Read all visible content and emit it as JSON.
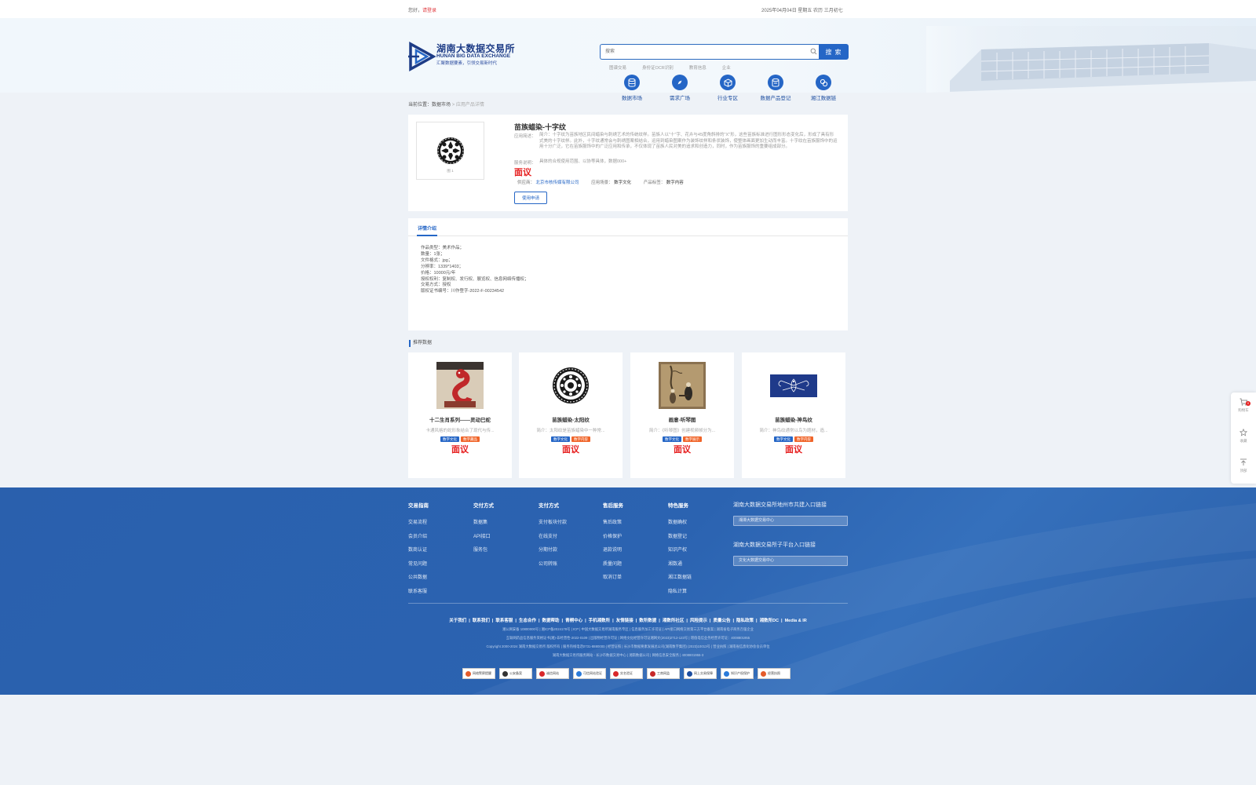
{
  "topbar": {
    "greeting": "您好，",
    "login": "请登录",
    "date": "2025年04月04日 星期五 农历 三月初七"
  },
  "logo": {
    "cn": "湖南大数据交易所",
    "en": "HUNAN BIG DATA EXCHANGE",
    "slogan": "汇聚数据要素，引领交易新时代"
  },
  "search": {
    "placeholder": "搜索",
    "button": "搜 索",
    "hotwords": [
      "图谱交易",
      "身份证OCR识别",
      "教育信息",
      "企业"
    ]
  },
  "nav": [
    {
      "label": "数据市场",
      "icon": "database-icon"
    },
    {
      "label": "需求广场",
      "icon": "compass-icon"
    },
    {
      "label": "行业专区",
      "icon": "cube-icon"
    },
    {
      "label": "数据产品登记",
      "icon": "register-icon"
    },
    {
      "label": "湘江数据链",
      "icon": "chain-icon"
    }
  ],
  "breadcrumb": {
    "prefix": "当前位置：",
    "level1": "数据市场",
    "sep": " > ",
    "current": "应用产品详情"
  },
  "product": {
    "image_caption": "图 1",
    "title": "苗族蜡染-十字纹",
    "intro_label": "应用简述：",
    "intro": "简介：十字纹为苗族地区民间蜡染与刺绣艺术的传统纹样。苗族人以\"十\"字、花卉与45度角斜排的\"X\"形，这些苗族标准进行图形形态变化后，形成了具有形式美的十字纹样。此外，十字纹通常会与刺绣图案相结合，运用到蜡染图案作为装饰纹样和条状装饰，使整体画面更加生动而丰富。十字纹在苗族服饰中的运用十分广泛，它在苗族服饰中的广泛应用和传承，不仅体现了苗族人民对美的追求和创造力，同时，作为苗族服饰的重要组成部分。",
    "service_label": "服务说明：",
    "service": "具体的合规使用范围、以协等具体，数据000+",
    "price": "面议",
    "provider_label": "供应商：",
    "provider": "北京市核传媒有限公司",
    "scene_label": "应用场景：",
    "scene": "数字文化",
    "tag_label": "产品标签：",
    "tag": "数字内容",
    "apply_button": "使用申请"
  },
  "detail": {
    "tab": "详情介绍",
    "lines": [
      "作品类型：美术作品；",
      "数量：1张；",
      "文件格式：jpg；",
      "分辨率：1339*1403；",
      "价格：10000元/年",
      "授权权利：复制权、发行权、展览权、信息网络传播权；",
      "交易方式：授权",
      "版权证书编号：川作登字-2022-F-00234542"
    ]
  },
  "recommend": {
    "title": "推荐数据",
    "items": [
      {
        "name": "十二生肖系列——灵动巳蛇",
        "desc": "卡通风格的蛇形象结合了现代与传...",
        "tags": [
          "数字文化",
          "数字藏品"
        ],
        "price": "面议"
      },
      {
        "name": "苗族蜡染-太阳纹",
        "desc": "简介：太阳纹是苗族蜡染中一种常...",
        "tags": [
          "数字文化",
          "数字内容"
        ],
        "price": "面议"
      },
      {
        "name": "画意-听琴图",
        "desc": "简介：《听琴图》创建视频帧分为...",
        "tags": [
          "数字文化",
          "数字展示"
        ],
        "price": "面议"
      },
      {
        "name": "苗族蜡染-神鸟纹",
        "desc": "简介：神鸟纹通常以鸟为题材，造...",
        "tags": [
          "数字文化",
          "数字内容"
        ],
        "price": "面议"
      }
    ]
  },
  "sidefloat": {
    "cart": "购物车",
    "cart_count": "0",
    "fav": "收藏",
    "top": "顶部"
  },
  "footer": {
    "columns": [
      {
        "title": "交易指南",
        "items": [
          "交易流程",
          "会员介绍",
          "数商认证",
          "常见问题",
          "公共数据",
          "联系客服"
        ]
      },
      {
        "title": "交付方式",
        "items": [
          "数据集",
          "API接口",
          "服务包"
        ]
      },
      {
        "title": "支付方式",
        "items": [
          "支付板块付款",
          "在线支付",
          "分期付款",
          "公司转账"
        ]
      },
      {
        "title": "售后服务",
        "items": [
          "售后政策",
          "价格保护",
          "退款说明",
          "质量问题",
          "取消订单"
        ]
      },
      {
        "title": "特色服务",
        "items": [
          "数据确权",
          "数据登记",
          "知识产权",
          "湘数通",
          "湘江数据链",
          "隐私计算"
        ]
      }
    ],
    "right_title1": "湖南大数据交易所地州市共建入口链接",
    "right_select1": "湘潭大数据交易中心",
    "right_title2": "湖南大数据交易所子平台入口链接",
    "right_select2": "文化大数据交易中心",
    "links": [
      "关于我们",
      "联系我们",
      "联系客服",
      "生态合作",
      "数据帮助",
      "青桐中心",
      "手机湘数所",
      "友情链接",
      "数所数据",
      "湘数所社区",
      "风险提示",
      "质量公告",
      "隐私政策",
      "湘数所DC",
      "Media & IR"
    ],
    "line1": "湘公网安备 10800000号  |  湘ICP备2024178号  |  ICP  |  中国大数据交易所湖南服务专区  |  信息服务加工许可证  |  API接口网络交易第三方平台备案  |  湖南省电子商务百强企业",
    "line2": "互联网药品信息服务资格证书(湘)-非经营性-2022-0109  |  出版物经营许可证  |  网络文化经营许可证湘网文(2023)2712-123号  |  增值电信业务经营许可证：4008801955",
    "line3": "Copyright 2000-2024 湖南大数据交易所 版权所有  |  服务热线电话0731-8880000  |  经营证照  |  长沙市数据要素发展总公司(湖南数字集团) (2023)10013号  |  营业执照  |  湖南省信息化协会会员单位",
    "line4": "湖南大数据交易所服务网站 - 长沙市数据交易中心  |  湘南数据公司  |  网络信息安全服务  |  4008801955-3",
    "badges": [
      "网络警察提醒",
      "公安备案",
      "诚信网站",
      "可信网站验证",
      "实名验证",
      "工商网监",
      "网上交易保障",
      "知识产权保护",
      "经营执照"
    ]
  }
}
